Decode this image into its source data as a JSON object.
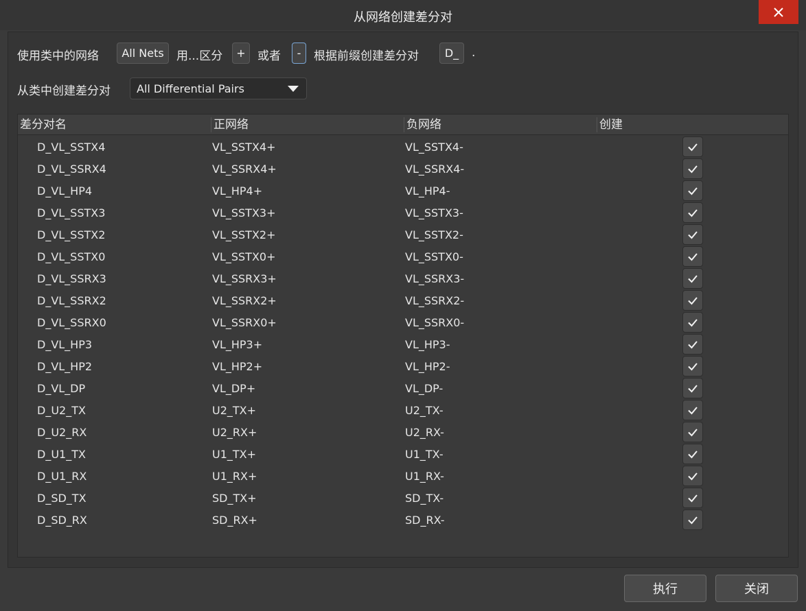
{
  "window": {
    "title": "从网络创建差分对"
  },
  "options": {
    "use_class_label": "使用类中的网络",
    "net_class_value": "All Nets",
    "distinguish_label": "用...区分",
    "plus_value": "+",
    "or_label": "或者",
    "minus_value": "-",
    "prefix_label": "根据前缀创建差分对",
    "prefix_value": "D_",
    "period": "."
  },
  "create_from_class": {
    "label": "从类中创建差分对",
    "selected": "All Differential Pairs"
  },
  "table": {
    "columns": [
      "差分对名",
      "正网络",
      "负网络",
      "创建"
    ],
    "rows": [
      {
        "name": "D_VL_SSTX4",
        "pos": "VL_SSTX4+",
        "neg": "VL_SSTX4-",
        "create": true
      },
      {
        "name": "D_VL_SSRX4",
        "pos": "VL_SSRX4+",
        "neg": "VL_SSRX4-",
        "create": true
      },
      {
        "name": "D_VL_HP4",
        "pos": "VL_HP4+",
        "neg": "VL_HP4-",
        "create": true
      },
      {
        "name": "D_VL_SSTX3",
        "pos": "VL_SSTX3+",
        "neg": "VL_SSTX3-",
        "create": true
      },
      {
        "name": "D_VL_SSTX2",
        "pos": "VL_SSTX2+",
        "neg": "VL_SSTX2-",
        "create": true
      },
      {
        "name": "D_VL_SSTX0",
        "pos": "VL_SSTX0+",
        "neg": "VL_SSTX0-",
        "create": true
      },
      {
        "name": "D_VL_SSRX3",
        "pos": "VL_SSRX3+",
        "neg": "VL_SSRX3-",
        "create": true
      },
      {
        "name": "D_VL_SSRX2",
        "pos": "VL_SSRX2+",
        "neg": "VL_SSRX2-",
        "create": true
      },
      {
        "name": "D_VL_SSRX0",
        "pos": "VL_SSRX0+",
        "neg": "VL_SSRX0-",
        "create": true
      },
      {
        "name": "D_VL_HP3",
        "pos": "VL_HP3+",
        "neg": "VL_HP3-",
        "create": true
      },
      {
        "name": "D_VL_HP2",
        "pos": "VL_HP2+",
        "neg": "VL_HP2-",
        "create": true
      },
      {
        "name": "D_VL_DP",
        "pos": "VL_DP+",
        "neg": "VL_DP-",
        "create": true
      },
      {
        "name": "D_U2_TX",
        "pos": "U2_TX+",
        "neg": "U2_TX-",
        "create": true
      },
      {
        "name": "D_U2_RX",
        "pos": "U2_RX+",
        "neg": "U2_RX-",
        "create": true
      },
      {
        "name": "D_U1_TX",
        "pos": "U1_TX+",
        "neg": "U1_TX-",
        "create": true
      },
      {
        "name": "D_U1_RX",
        "pos": "U1_RX+",
        "neg": "U1_RX-",
        "create": true
      },
      {
        "name": "D_SD_TX",
        "pos": "SD_TX+",
        "neg": "SD_TX-",
        "create": true
      },
      {
        "name": "D_SD_RX",
        "pos": "SD_RX+",
        "neg": "SD_RX-",
        "create": true
      }
    ]
  },
  "buttons": {
    "execute": "执行",
    "close": "关闭"
  },
  "colors": {
    "close_bg": "#c42b1c",
    "background": "#353535",
    "selected_border": "#7aa6d6"
  },
  "icons": {
    "close": "close-icon",
    "check": "checkmark-icon",
    "dropdown": "chevron-down-icon"
  }
}
